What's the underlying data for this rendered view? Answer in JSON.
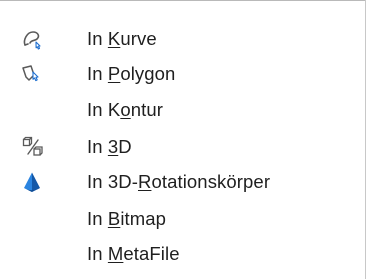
{
  "menu": {
    "items": [
      {
        "prefix": "In ",
        "mnemonic": "K",
        "suffix": "urve",
        "icon": "curve-icon"
      },
      {
        "prefix": "In ",
        "mnemonic": "P",
        "suffix": "olygon",
        "icon": "polygon-icon"
      },
      {
        "prefix": "In K",
        "mnemonic": "o",
        "suffix": "ntur",
        "icon": ""
      },
      {
        "prefix": "In ",
        "mnemonic": "3",
        "suffix": "D",
        "icon": "3d-convert-icon"
      },
      {
        "prefix": "In 3D-",
        "mnemonic": "R",
        "suffix": "otationskörper",
        "icon": "cone-3d-icon"
      },
      {
        "prefix": "In ",
        "mnemonic": "B",
        "suffix": "itmap",
        "icon": ""
      },
      {
        "prefix": "In ",
        "mnemonic": "M",
        "suffix": "etaFile",
        "icon": ""
      }
    ]
  },
  "colors": {
    "text": "#1f1f1f",
    "icon_blue": "#1e6fd0",
    "icon_gray": "#5a5a5a"
  }
}
